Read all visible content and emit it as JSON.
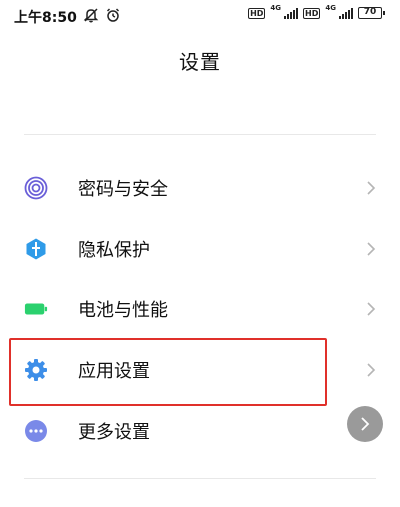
{
  "status_bar": {
    "time": "上午8:50",
    "network_label_1": "4G",
    "network_label_2": "4G",
    "hd_label_1": "HD",
    "hd_label_2": "HD",
    "battery": "70"
  },
  "header": {
    "title": "设置"
  },
  "settings": {
    "items": [
      {
        "label": "密码与安全",
        "icon": "fingerprint-icon",
        "color": "#6a5fd8"
      },
      {
        "label": "隐私保护",
        "icon": "privacy-shield-icon",
        "color": "#2f9be8"
      },
      {
        "label": "电池与性能",
        "icon": "battery-icon",
        "color": "#2bd16e"
      },
      {
        "label": "应用设置",
        "icon": "gear-icon",
        "color": "#3d8ee8"
      },
      {
        "label": "更多设置",
        "icon": "more-dots-icon",
        "color": "#7a89e8"
      }
    ]
  },
  "colors": {
    "highlight": "#e0302a",
    "chevron": "#b5b5b5",
    "fab": "#9a9a9a"
  }
}
